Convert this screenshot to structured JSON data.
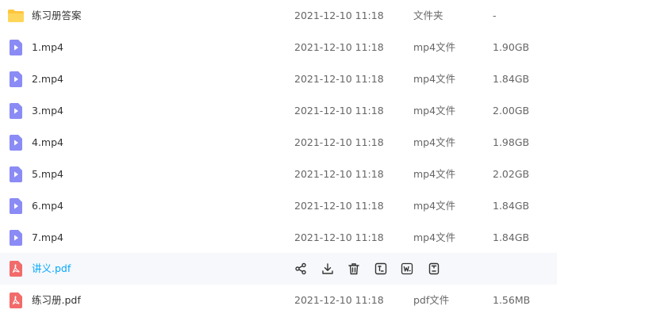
{
  "files": [
    {
      "name": "练习册答案",
      "date": "2021-12-10 11:18",
      "type": "文件夹",
      "size": "-",
      "kind": "folder-icon"
    },
    {
      "name": "1.mp4",
      "date": "2021-12-10 11:18",
      "type": "mp4文件",
      "size": "1.90GB",
      "kind": "video-file-icon"
    },
    {
      "name": "2.mp4",
      "date": "2021-12-10 11:18",
      "type": "mp4文件",
      "size": "1.84GB",
      "kind": "video-file-icon"
    },
    {
      "name": "3.mp4",
      "date": "2021-12-10 11:18",
      "type": "mp4文件",
      "size": "2.00GB",
      "kind": "video-file-icon"
    },
    {
      "name": "4.mp4",
      "date": "2021-12-10 11:18",
      "type": "mp4文件",
      "size": "1.98GB",
      "kind": "video-file-icon"
    },
    {
      "name": "5.mp4",
      "date": "2021-12-10 11:18",
      "type": "mp4文件",
      "size": "2.02GB",
      "kind": "video-file-icon"
    },
    {
      "name": "6.mp4",
      "date": "2021-12-10 11:18",
      "type": "mp4文件",
      "size": "1.84GB",
      "kind": "video-file-icon"
    },
    {
      "name": "7.mp4",
      "date": "2021-12-10 11:18",
      "type": "mp4文件",
      "size": "1.84GB",
      "kind": "video-file-icon"
    },
    {
      "name": "讲义.pdf",
      "hovered": true,
      "kind": "pdf-file-icon",
      "actions": [
        "share-icon",
        "download-icon",
        "delete-icon",
        "text-convert-icon",
        "word-convert-icon",
        "more-doc-icon"
      ]
    },
    {
      "name": "练习册.pdf",
      "date": "2021-12-10 11:18",
      "type": "pdf文件",
      "size": "1.56MB",
      "kind": "pdf-file-icon"
    }
  ],
  "colors": {
    "folder": "#ffc63d",
    "video": "#8b8bf5",
    "pdf": "#f26b6b",
    "link": "#06a7ff",
    "hover_bg": "#f6f8fb",
    "action_icon": "#333333"
  }
}
